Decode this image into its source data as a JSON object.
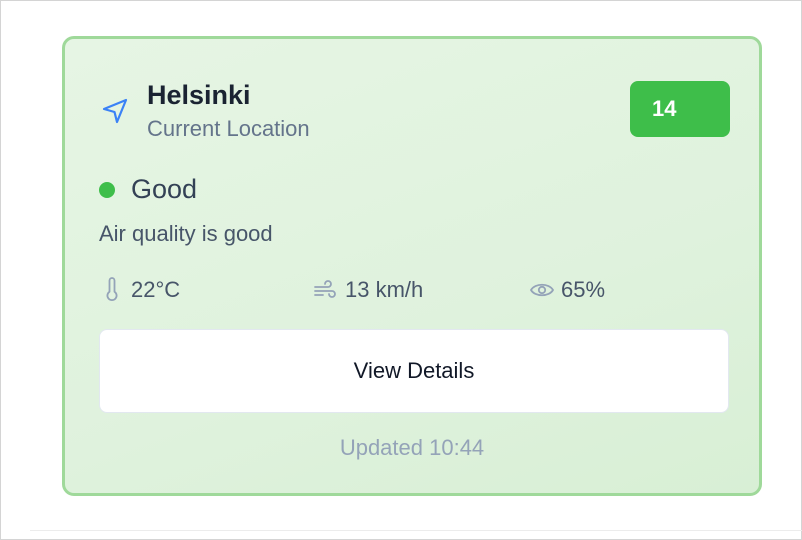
{
  "location": {
    "city": "Helsinki",
    "subtitle": "Current Location",
    "icon": "navigation-arrow-icon"
  },
  "aqi": {
    "value": "14",
    "color": "#3ebe4a"
  },
  "status": {
    "label": "Good",
    "description": "Air quality is good",
    "dot_color": "#3ebe4a"
  },
  "metrics": {
    "temperature": {
      "icon": "thermometer-icon",
      "value": "22°C"
    },
    "wind": {
      "icon": "wind-icon",
      "value": "13 km/h"
    },
    "humidity": {
      "icon": "eye-icon",
      "value": "65%"
    }
  },
  "actions": {
    "details_label": "View Details"
  },
  "footer": {
    "updated": "Updated 10:44"
  },
  "colors": {
    "card_border": "#9fd99a",
    "card_background": "#e2f4e0",
    "accent_blue": "#3b82f6"
  }
}
